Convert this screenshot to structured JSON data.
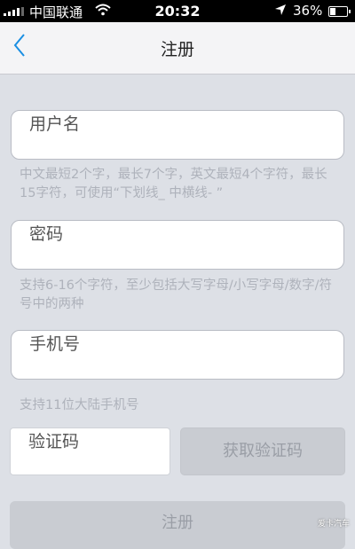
{
  "status_bar": {
    "carrier": "中国联通",
    "time": "20:32",
    "battery_percent": "36%",
    "battery_level": 0.36
  },
  "nav": {
    "title": "注册"
  },
  "form": {
    "username": {
      "placeholder": "用户名",
      "hint": "中文最短2个字，最长7个字，英文最短4个字符，最长15字符，可使用“下划线_ 中横线- ”"
    },
    "password": {
      "placeholder": "密码",
      "hint": "支持6-16个字符，至少包括大写字母/小写字母/数字/符号中的两种"
    },
    "phone": {
      "placeholder": "手机号",
      "hint": "支持11位大陆手机号"
    },
    "code": {
      "placeholder": "验证码",
      "get_code_label": "获取验证码"
    },
    "submit_label": "注册"
  },
  "watermark": "爱卡汽车",
  "colors": {
    "background": "#dde0e6",
    "navbar": "#f4f4f6",
    "back_arrow": "#1a8fe3",
    "hint_text": "#aeb2bb",
    "disabled_button": "#c9ccd2"
  }
}
